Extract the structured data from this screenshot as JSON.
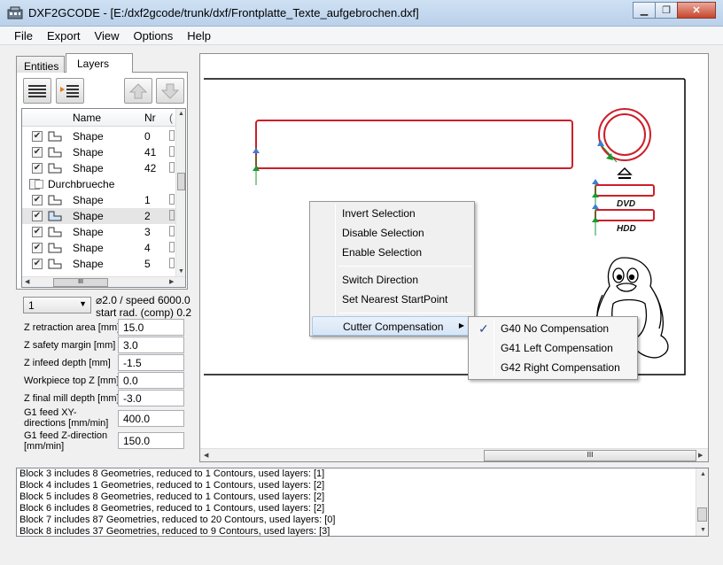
{
  "window": {
    "title": "DXF2GCODE - [E:/dxf2gcode/trunk/dxf/Frontplatte_Texte_aufgebrochen.dxf]",
    "minimize": "▁",
    "maximize": "❐",
    "close": "✕"
  },
  "menu": [
    "File",
    "Export",
    "View",
    "Options",
    "Help"
  ],
  "tabs": {
    "entities": "Entities",
    "layers": "Layers"
  },
  "tree": {
    "columns": {
      "name": "Name",
      "nr": "Nr"
    },
    "rows": [
      {
        "checked": true,
        "name": "Shape",
        "nr": "0",
        "indent": true
      },
      {
        "checked": true,
        "name": "Shape",
        "nr": "41",
        "indent": true
      },
      {
        "checked": true,
        "name": "Shape",
        "nr": "42",
        "indent": true
      },
      {
        "checked": false,
        "name": "Durchbrueche",
        "nr": "",
        "indent": false
      },
      {
        "checked": true,
        "name": "Shape",
        "nr": "1",
        "indent": true
      },
      {
        "checked": true,
        "name": "Shape",
        "nr": "2",
        "indent": true,
        "selected": true
      },
      {
        "checked": true,
        "name": "Shape",
        "nr": "3",
        "indent": true
      },
      {
        "checked": true,
        "name": "Shape",
        "nr": "4",
        "indent": true
      },
      {
        "checked": true,
        "name": "Shape",
        "nr": "5",
        "indent": true
      }
    ]
  },
  "tool": {
    "selected": "1",
    "info_line1": "⌀2.0 / speed 6000.0",
    "info_line2": "start rad. (comp) 0.2"
  },
  "params": [
    {
      "label": "Z retraction area [mm]",
      "value": "15.0"
    },
    {
      "label": "Z safety margin [mm]",
      "value": "3.0"
    },
    {
      "label": "Z infeed depth [mm]",
      "value": "-1.5"
    },
    {
      "label": "Workpiece top Z [mm]",
      "value": "0.0"
    },
    {
      "label": "Z final mill depth [mm]",
      "value": "-3.0"
    },
    {
      "label": "G1 feed XY-directions [mm/min]",
      "value": "400.0"
    },
    {
      "label": "G1 feed Z-direction [mm/min]",
      "value": "150.0"
    }
  ],
  "canvas": {
    "dvd_label": "DVD",
    "hdd_label": "HDD"
  },
  "context_menu": {
    "items": [
      "Invert Selection",
      "Disable Selection",
      "Enable Selection",
      "Switch Direction",
      "Set Nearest StartPoint",
      "Cutter Compensation"
    ],
    "submenu_arrow": "▶"
  },
  "submenu": {
    "items": [
      "G40 No Compensation",
      "G41 Left Compensation",
      "G42 Right Compensation"
    ],
    "checked_index": 0,
    "check": "✓"
  },
  "log": [
    "Block 3 includes 8 Geometries, reduced to 1 Contours, used layers: [1]",
    "Block 4 includes 1 Geometries, reduced to 1 Contours, used layers: [2]",
    "Block 5 includes 8 Geometries, reduced to 1 Contours, used layers: [2]",
    "Block 6 includes 8 Geometries, reduced to 1 Contours, used layers: [2]",
    "Block 7 includes 87 Geometries, reduced to 20 Contours, used layers: [0]",
    "Block 8 includes 37 Geometries, reduced to 9 Contours, used layers: [3]"
  ],
  "colors": {
    "contour": "#cc1f2a",
    "start_arrow": "#1a9a2e",
    "dir_arrow": "#3a7fd0"
  }
}
